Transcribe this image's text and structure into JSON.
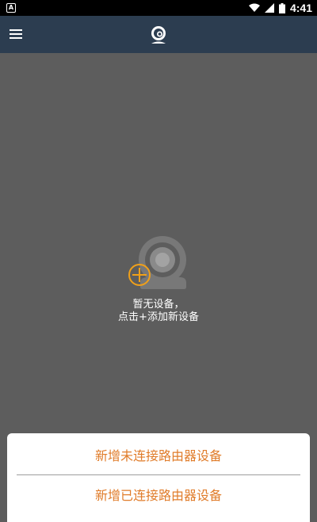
{
  "status_bar": {
    "notification_icon": "A",
    "time": "4:41",
    "icons": [
      "wifi-icon",
      "signal-icon",
      "battery-icon"
    ]
  },
  "app_bar": {
    "menu_icon": "menu-icon",
    "logo_icon": "camera-logo-icon",
    "background": "#2c3d50"
  },
  "empty_state": {
    "line1": "暂无设备，",
    "line2": "点击+添加新设备",
    "accent": "#f0a019"
  },
  "bottom_sheet": {
    "option_unconnected": "新增未连接路由器设备",
    "option_connected": "新增已连接路由器设备",
    "text_color": "#e07c2a"
  }
}
